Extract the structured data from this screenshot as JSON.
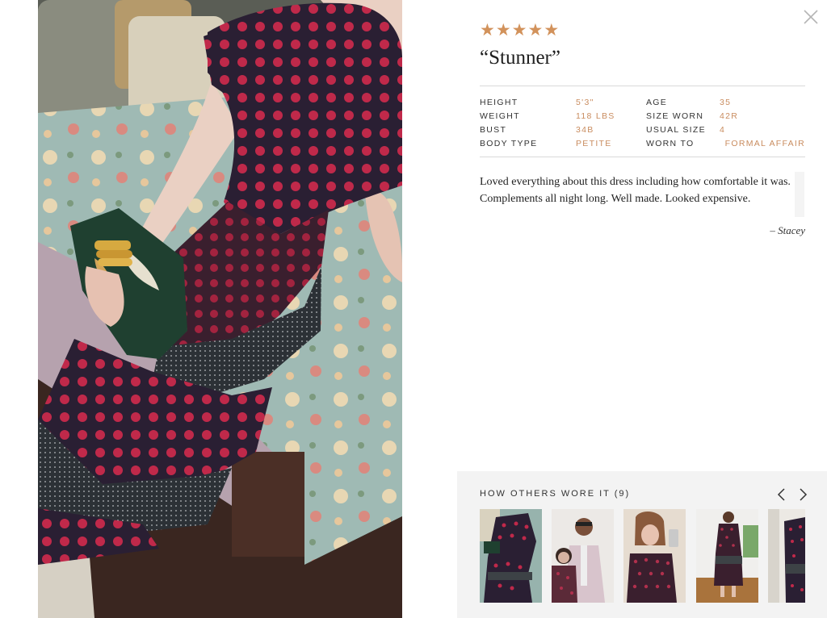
{
  "review": {
    "rating": 5,
    "stars": [
      "★",
      "★",
      "★",
      "★",
      "★"
    ],
    "title": "“Stunner”",
    "text": "Loved everything about this dress including how comfortable it was. Complements all night long. Well made. Looked expensive.",
    "author": "– Stacey"
  },
  "specs": [
    {
      "label": "HEIGHT",
      "value": "5'3\"",
      "label2": "AGE",
      "value2": "35"
    },
    {
      "label": "WEIGHT",
      "value": "118 LBS",
      "label2": "SIZE WORN",
      "value2": "42R"
    },
    {
      "label": "BUST",
      "value": "34B",
      "label2": "USUAL SIZE",
      "value2": "4"
    },
    {
      "label": "BODY TYPE",
      "value": "PETITE",
      "label2": "WORN TO",
      "value2": "FORMAL AFFAIR"
    }
  ],
  "others": {
    "title": "HOW OTHERS WORE IT (9)",
    "prev_icon": "chevron-left-icon",
    "next_icon": "chevron-right-icon"
  },
  "colors": {
    "star": "#d2925b",
    "accent": "#c98c5f",
    "dress_base": "#2a1f33",
    "dress_dot": "#c0294a"
  }
}
